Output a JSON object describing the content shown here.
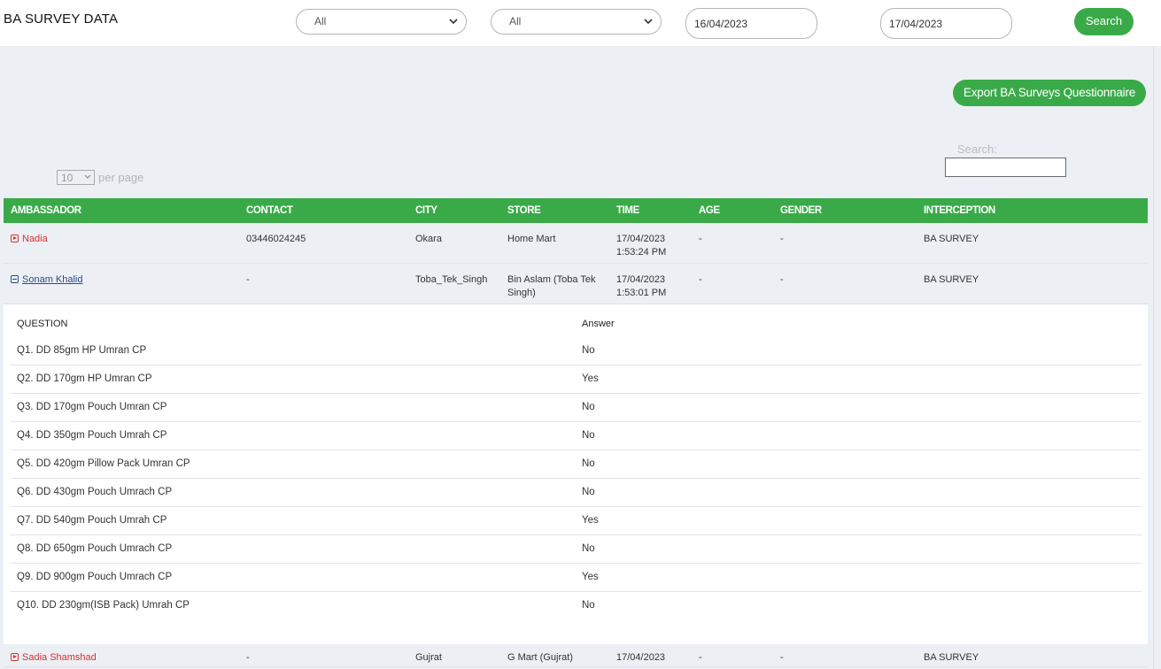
{
  "header": {
    "title": "BA SURVEY DATA",
    "filter1": "All",
    "filter2": "All",
    "date_from": "16/04/2023",
    "date_to": "17/04/2023",
    "search_button": "Search"
  },
  "toolbar": {
    "export_button": "Export BA Surveys Questionnaire",
    "search_label": "Search:",
    "search_value": "",
    "per_page_value": "10",
    "per_page_label": "per page"
  },
  "table": {
    "columns": [
      "AMBASSADOR",
      "CONTACT",
      "CITY",
      "STORE",
      "TIME",
      "AGE",
      "GENDER",
      "INTERCEPTION"
    ],
    "rows": [
      {
        "ambassador": "Nadia",
        "contact": "03446024245",
        "city": "Okara",
        "store": "Home Mart",
        "time_date": "17/04/2023",
        "time_clock": "1:53:24 PM",
        "age": "-",
        "gender": "-",
        "interception": "BA SURVEY",
        "expanded": false
      },
      {
        "ambassador": "Sonam Khalid",
        "contact": "-",
        "city": "Toba_Tek_Singh",
        "store_line1": "Bin Aslam (Toba Tek",
        "store_line2": "Singh)",
        "time_date": "17/04/2023",
        "time_clock": "1:53:01 PM",
        "age": "-",
        "gender": "-",
        "interception": "BA SURVEY",
        "expanded": true
      },
      {
        "ambassador": "Sadia Shamshad",
        "contact": "-",
        "city": "Gujrat",
        "store": "G Mart (Gujrat)",
        "time_date": "17/04/2023",
        "age": "-",
        "gender": "-",
        "interception": "BA SURVEY",
        "expanded": false
      }
    ]
  },
  "detail": {
    "question_header": "QUESTION",
    "answer_header": "Answer",
    "items": [
      {
        "q": "Q1. DD 85gm HP Umran CP",
        "a": "No"
      },
      {
        "q": "Q2. DD 170gm HP Umran CP",
        "a": "Yes"
      },
      {
        "q": "Q3. DD 170gm Pouch Umran CP",
        "a": "No"
      },
      {
        "q": "Q4. DD 350gm Pouch Umrah CP",
        "a": "No"
      },
      {
        "q": "Q5. DD 420gm Pillow Pack Umran CP",
        "a": "No"
      },
      {
        "q": "Q6. DD 430gm Pouch Umrach CP",
        "a": "No"
      },
      {
        "q": "Q7. DD 540gm Pouch Umrah CP",
        "a": "Yes"
      },
      {
        "q": "Q8. DD 650gm Pouch Umrach CP",
        "a": "No"
      },
      {
        "q": "Q9. DD 900gm Pouch Umrach CP",
        "a": "Yes"
      },
      {
        "q": "Q10. DD 230gm(ISB Pack) Umrah CP",
        "a": "No"
      }
    ]
  },
  "colors": {
    "accent": "#3aaa49",
    "expand_red": "#d43131",
    "collapse_blue": "#2c4a8a",
    "page_bg": "#eceff3"
  },
  "icons": {
    "expand": "expand-plus-icon",
    "collapse": "collapse-minus-icon",
    "dropdown": "chevron-down-icon"
  }
}
